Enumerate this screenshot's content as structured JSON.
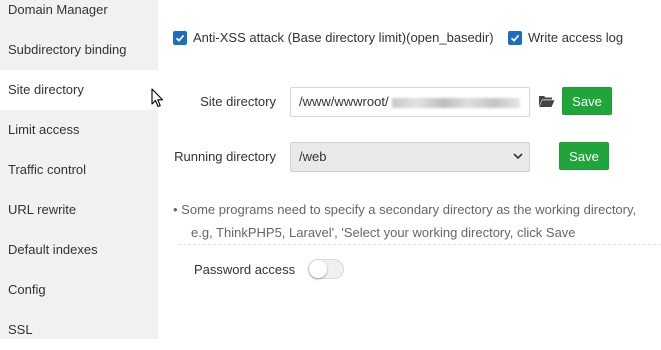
{
  "sidebar": {
    "items": [
      {
        "label": "Domain Manager"
      },
      {
        "label": "Subdirectory binding"
      },
      {
        "label": "Site directory"
      },
      {
        "label": "Limit access"
      },
      {
        "label": "Traffic control"
      },
      {
        "label": "URL rewrite"
      },
      {
        "label": "Default indexes"
      },
      {
        "label": "Config"
      },
      {
        "label": "SSL"
      }
    ],
    "active": "Site directory"
  },
  "options": {
    "anti_xss": {
      "label": "Anti-XSS attack (Base directory limit)(open_basedir)",
      "checked": true
    },
    "access_log": {
      "label": "Write access log",
      "checked": true
    }
  },
  "site_directory": {
    "label": "Site directory",
    "value": "/www/wwwroot/",
    "folder_icon": "folder-open-icon",
    "save_label": "Save"
  },
  "running_directory": {
    "label": "Running directory",
    "value": "/web",
    "save_label": "Save"
  },
  "tip": {
    "line1": "• Some programs need to specify a secondary directory as the working directory,",
    "line2": "e.g, ThinkPHP5, Laravel', 'Select your working directory, click Save"
  },
  "password_access": {
    "label": "Password access",
    "enabled": false
  },
  "colors": {
    "accent": "#20a53a",
    "checkbox": "#1b6ec2",
    "sidebar_bg": "#f1f1f1"
  }
}
